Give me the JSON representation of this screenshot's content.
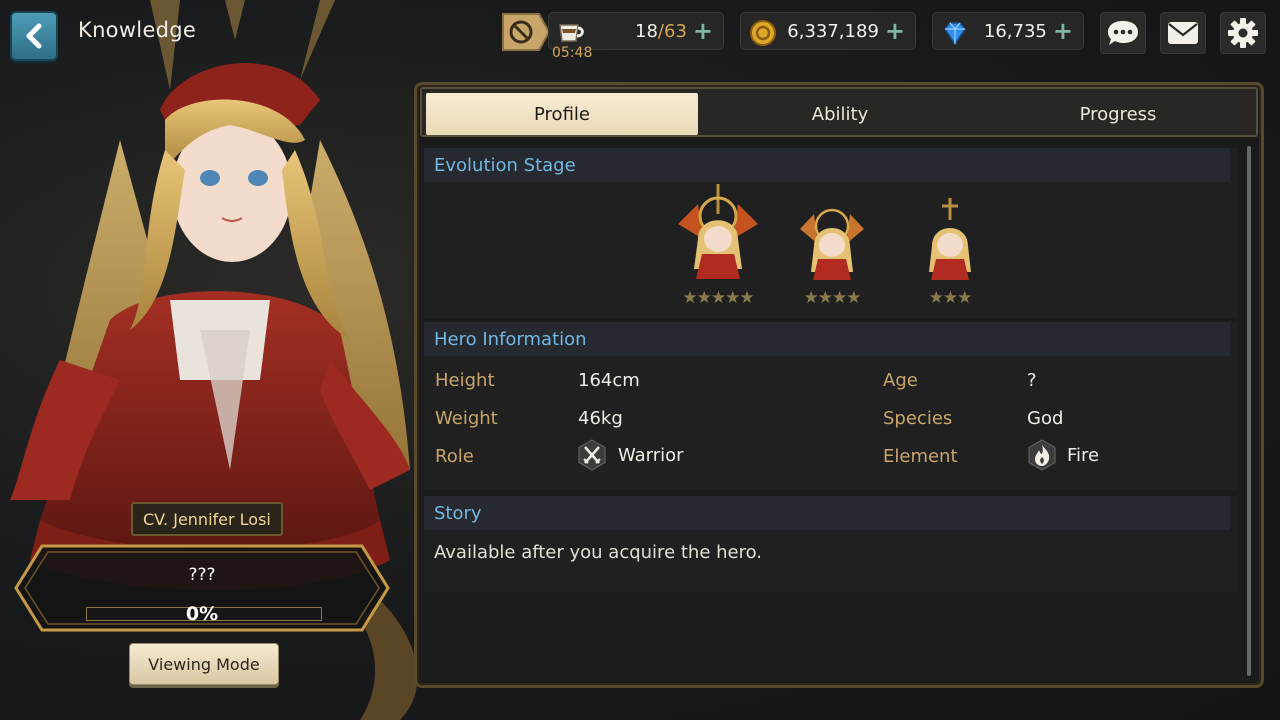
{
  "header": {
    "title": "Knowledge",
    "stamina": {
      "timer": "05:48",
      "current": "18",
      "max": "/63"
    },
    "gold": "6,337,189",
    "gems": "16,735"
  },
  "hero": {
    "voice_actor": "CV. Jennifer Losi",
    "mystery": "???",
    "progress_percent": "0%",
    "progress_value": 0,
    "viewing_mode_label": "Viewing Mode"
  },
  "tabs": [
    {
      "label": "Profile",
      "active": true
    },
    {
      "label": "Ability",
      "active": false
    },
    {
      "label": "Progress",
      "active": false
    }
  ],
  "evolution": {
    "title": "Evolution Stage",
    "stages": [
      {
        "stars": "★★★★★"
      },
      {
        "stars": "★★★★"
      },
      {
        "stars": "★★★"
      }
    ]
  },
  "info": {
    "title": "Hero Information",
    "height_label": "Height",
    "height": "164cm",
    "weight_label": "Weight",
    "weight": "46kg",
    "role_label": "Role",
    "role": "Warrior",
    "role_icon": "crossed-swords-icon",
    "age_label": "Age",
    "age": "?",
    "species_label": "Species",
    "species": "God",
    "element_label": "Element",
    "element": "Fire",
    "element_icon": "flame-icon"
  },
  "story": {
    "title": "Story",
    "text": "Available after you acquire the hero."
  },
  "colors": {
    "accent_blue": "#72b8e0",
    "label_gold": "#c8a56a",
    "panel_border": "#5a4a2c"
  }
}
